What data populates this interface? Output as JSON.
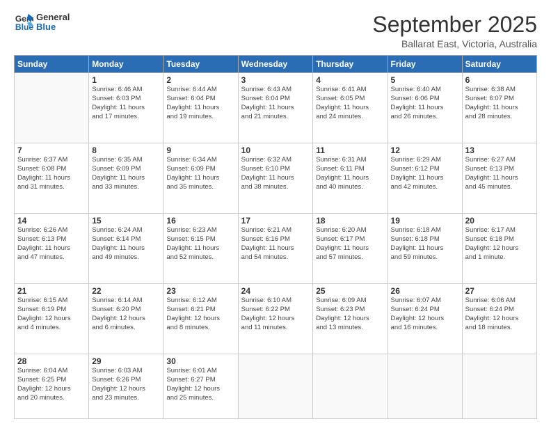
{
  "logo": {
    "line1": "General",
    "line2": "Blue"
  },
  "header": {
    "month": "September 2025",
    "location": "Ballarat East, Victoria, Australia"
  },
  "weekdays": [
    "Sunday",
    "Monday",
    "Tuesday",
    "Wednesday",
    "Thursday",
    "Friday",
    "Saturday"
  ],
  "weeks": [
    [
      {
        "day": "",
        "info": ""
      },
      {
        "day": "1",
        "info": "Sunrise: 6:46 AM\nSunset: 6:03 PM\nDaylight: 11 hours\nand 17 minutes."
      },
      {
        "day": "2",
        "info": "Sunrise: 6:44 AM\nSunset: 6:04 PM\nDaylight: 11 hours\nand 19 minutes."
      },
      {
        "day": "3",
        "info": "Sunrise: 6:43 AM\nSunset: 6:04 PM\nDaylight: 11 hours\nand 21 minutes."
      },
      {
        "day": "4",
        "info": "Sunrise: 6:41 AM\nSunset: 6:05 PM\nDaylight: 11 hours\nand 24 minutes."
      },
      {
        "day": "5",
        "info": "Sunrise: 6:40 AM\nSunset: 6:06 PM\nDaylight: 11 hours\nand 26 minutes."
      },
      {
        "day": "6",
        "info": "Sunrise: 6:38 AM\nSunset: 6:07 PM\nDaylight: 11 hours\nand 28 minutes."
      }
    ],
    [
      {
        "day": "7",
        "info": "Sunrise: 6:37 AM\nSunset: 6:08 PM\nDaylight: 11 hours\nand 31 minutes."
      },
      {
        "day": "8",
        "info": "Sunrise: 6:35 AM\nSunset: 6:09 PM\nDaylight: 11 hours\nand 33 minutes."
      },
      {
        "day": "9",
        "info": "Sunrise: 6:34 AM\nSunset: 6:09 PM\nDaylight: 11 hours\nand 35 minutes."
      },
      {
        "day": "10",
        "info": "Sunrise: 6:32 AM\nSunset: 6:10 PM\nDaylight: 11 hours\nand 38 minutes."
      },
      {
        "day": "11",
        "info": "Sunrise: 6:31 AM\nSunset: 6:11 PM\nDaylight: 11 hours\nand 40 minutes."
      },
      {
        "day": "12",
        "info": "Sunrise: 6:29 AM\nSunset: 6:12 PM\nDaylight: 11 hours\nand 42 minutes."
      },
      {
        "day": "13",
        "info": "Sunrise: 6:27 AM\nSunset: 6:13 PM\nDaylight: 11 hours\nand 45 minutes."
      }
    ],
    [
      {
        "day": "14",
        "info": "Sunrise: 6:26 AM\nSunset: 6:13 PM\nDaylight: 11 hours\nand 47 minutes."
      },
      {
        "day": "15",
        "info": "Sunrise: 6:24 AM\nSunset: 6:14 PM\nDaylight: 11 hours\nand 49 minutes."
      },
      {
        "day": "16",
        "info": "Sunrise: 6:23 AM\nSunset: 6:15 PM\nDaylight: 11 hours\nand 52 minutes."
      },
      {
        "day": "17",
        "info": "Sunrise: 6:21 AM\nSunset: 6:16 PM\nDaylight: 11 hours\nand 54 minutes."
      },
      {
        "day": "18",
        "info": "Sunrise: 6:20 AM\nSunset: 6:17 PM\nDaylight: 11 hours\nand 57 minutes."
      },
      {
        "day": "19",
        "info": "Sunrise: 6:18 AM\nSunset: 6:18 PM\nDaylight: 11 hours\nand 59 minutes."
      },
      {
        "day": "20",
        "info": "Sunrise: 6:17 AM\nSunset: 6:18 PM\nDaylight: 12 hours\nand 1 minute."
      }
    ],
    [
      {
        "day": "21",
        "info": "Sunrise: 6:15 AM\nSunset: 6:19 PM\nDaylight: 12 hours\nand 4 minutes."
      },
      {
        "day": "22",
        "info": "Sunrise: 6:14 AM\nSunset: 6:20 PM\nDaylight: 12 hours\nand 6 minutes."
      },
      {
        "day": "23",
        "info": "Sunrise: 6:12 AM\nSunset: 6:21 PM\nDaylight: 12 hours\nand 8 minutes."
      },
      {
        "day": "24",
        "info": "Sunrise: 6:10 AM\nSunset: 6:22 PM\nDaylight: 12 hours\nand 11 minutes."
      },
      {
        "day": "25",
        "info": "Sunrise: 6:09 AM\nSunset: 6:23 PM\nDaylight: 12 hours\nand 13 minutes."
      },
      {
        "day": "26",
        "info": "Sunrise: 6:07 AM\nSunset: 6:24 PM\nDaylight: 12 hours\nand 16 minutes."
      },
      {
        "day": "27",
        "info": "Sunrise: 6:06 AM\nSunset: 6:24 PM\nDaylight: 12 hours\nand 18 minutes."
      }
    ],
    [
      {
        "day": "28",
        "info": "Sunrise: 6:04 AM\nSunset: 6:25 PM\nDaylight: 12 hours\nand 20 minutes."
      },
      {
        "day": "29",
        "info": "Sunrise: 6:03 AM\nSunset: 6:26 PM\nDaylight: 12 hours\nand 23 minutes."
      },
      {
        "day": "30",
        "info": "Sunrise: 6:01 AM\nSunset: 6:27 PM\nDaylight: 12 hours\nand 25 minutes."
      },
      {
        "day": "",
        "info": ""
      },
      {
        "day": "",
        "info": ""
      },
      {
        "day": "",
        "info": ""
      },
      {
        "day": "",
        "info": ""
      }
    ]
  ]
}
